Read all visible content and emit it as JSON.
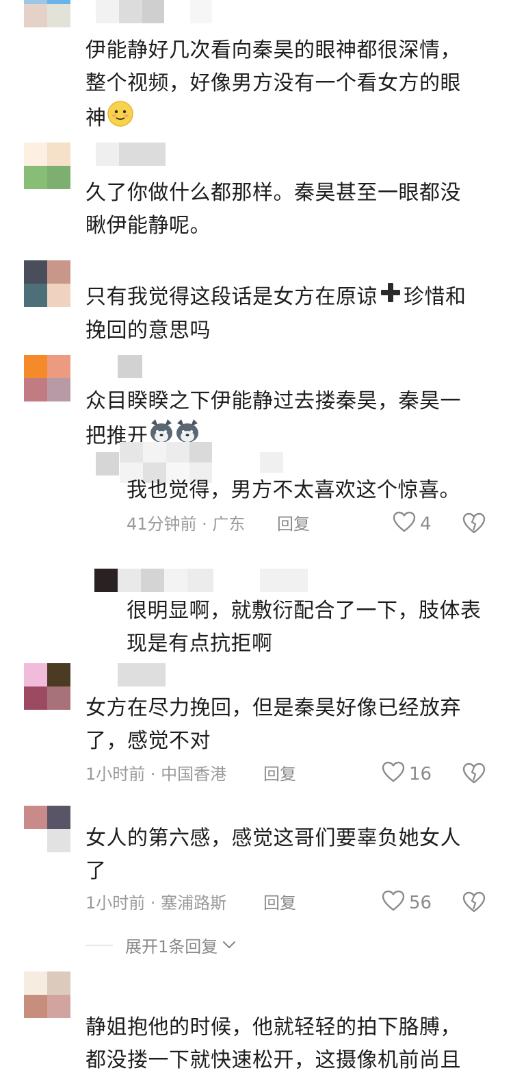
{
  "comments": [
    {
      "text_line1": "伊能静好几次看向秦昊的眼神都很深情，",
      "text_line2": "整个视频，好像男方没有一个看女方的眼",
      "text_line3": "神",
      "emoji": "smile-emoji"
    },
    {
      "text_line1": "久了你做什么都那样。秦昊甚至一眼都没",
      "text_line2": "瞅伊能静呢。"
    },
    {
      "text_line1": "只有我觉得这段话是女方在原谅",
      "plus_icon": "heavy-plus-icon",
      "text_line1b": "珍惜和",
      "text_line2": "挽回的意思吗"
    },
    {
      "text_line1": "众目睽睽之下伊能静过去搂秦昊，秦昊一",
      "text_line2": "把推开",
      "emoji": "husky-dog-emoji"
    },
    {
      "text_line1": "女方在尽力挽回，但是秦昊好像已经放弃",
      "text_line2": "了，感觉不对",
      "time": "1小时前 · 中国香港",
      "reply": "回复",
      "likes": "16"
    },
    {
      "text_line1": "女人的第六感，感觉这哥们要辜负她女人",
      "text_line2": "了",
      "time": "1小时前 · 塞浦路斯",
      "reply": "回复",
      "likes": "56",
      "expand": "展开1条回复"
    },
    {
      "text_line1": "静姐抱他的时候，他就轻轻的拍下胳膊，",
      "text_line2": "都没搂一下就快速松开，这摄像机前尚且"
    }
  ],
  "replies": [
    {
      "text": "我也觉得，男方不太喜欢这个惊喜。",
      "time": "41分钟前 · 广东",
      "reply": "回复",
      "likes": "4"
    },
    {
      "text_line1": "很明显啊，就敷衍配合了一下，肢体表",
      "text_line2": "现是有点抗拒啊"
    }
  ],
  "colors": {
    "meta": "#9a9a9a",
    "text": "#1d1d1d",
    "icon": "#8a8a8a"
  }
}
